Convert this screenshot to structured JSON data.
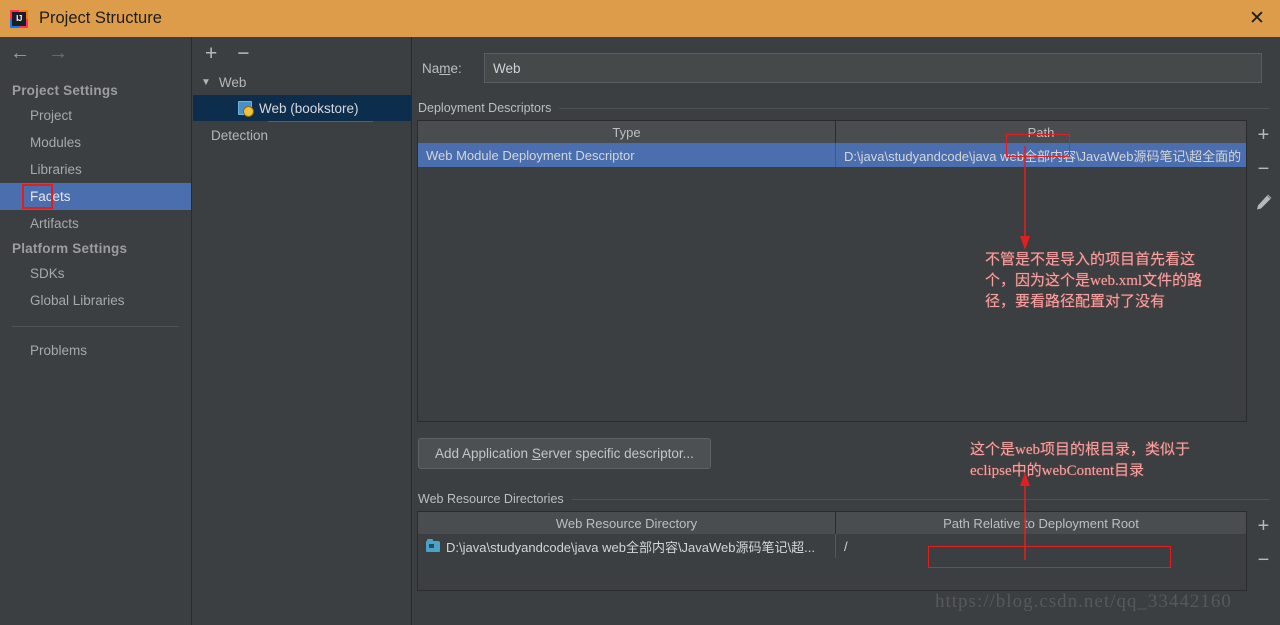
{
  "window": {
    "title": "Project Structure",
    "logo_text": "IJ",
    "close_label": "✕",
    "titlebar_color": "#dd9c4a"
  },
  "nav": {
    "back_label": "←",
    "forward_label": "→"
  },
  "sidebar": {
    "groups": [
      {
        "label": "Project Settings",
        "items": [
          {
            "label": "Project",
            "selected": false,
            "boxed": false
          },
          {
            "label": "Modules",
            "selected": false,
            "boxed": false
          },
          {
            "label": "Libraries",
            "selected": false,
            "boxed": false
          },
          {
            "label": "Facets",
            "selected": true,
            "boxed": true
          },
          {
            "label": "Artifacts",
            "selected": false,
            "boxed": false
          }
        ]
      },
      {
        "label": "Platform Settings",
        "items": [
          {
            "label": "SDKs",
            "selected": false,
            "boxed": false
          },
          {
            "label": "Global Libraries",
            "selected": false,
            "boxed": false
          }
        ]
      }
    ],
    "extra_items": [
      {
        "label": "Problems",
        "selected": false,
        "boxed": false
      }
    ]
  },
  "tree_panel": {
    "toolbar": {
      "add_label": "+",
      "remove_label": "−"
    },
    "nodes": [
      {
        "label": "Web",
        "type": "root",
        "caret": "▼",
        "selected": false
      },
      {
        "label": "Web (bookstore)",
        "type": "facet",
        "selected": true
      },
      {
        "label": "Detection",
        "type": "root",
        "selected": false
      }
    ]
  },
  "main": {
    "name_field": {
      "label_prefix": "Na",
      "label_mnemonic": "m",
      "label_suffix": "e:",
      "value": "Web",
      "placeholder": ""
    },
    "deployment_descriptors": {
      "section_label": "Deployment Descriptors",
      "columns": [
        "Type",
        "Path"
      ],
      "rows": [
        {
          "type": "Web Module Deployment Descriptor",
          "path": "D:\\java\\studyandcode\\java web全部内容\\JavaWeb源码笔记\\超全面的",
          "selected": true
        }
      ],
      "side_buttons": [
        "add",
        "remove",
        "edit"
      ],
      "add_button_label": "+",
      "remove_button_label": "−",
      "edit_button_label": "pencil"
    },
    "add_descriptor_button": {
      "prefix": "Add Application ",
      "mnemonic": "S",
      "suffix": "erver specific descriptor..."
    },
    "web_resource_directories": {
      "section_label": "Web Resource Directories",
      "columns": [
        "Web Resource Directory",
        "Path Relative to Deployment Root"
      ],
      "rows": [
        {
          "directory": "D:\\java\\studyandcode\\java web全部内容\\JavaWeb源码笔记\\超...",
          "relative": "/"
        }
      ],
      "add_button_label": "+",
      "remove_button_label": "−"
    }
  },
  "annotations": {
    "note_1": "不管是不是导入的项目首先看这\n个，因为这个是web.xml文件的路\n径，要看路径配置对了没有",
    "note_2": "这个是web项目的根目录，类似于\neclipse中的webContent目录",
    "color": "#e02020"
  },
  "watermark": {
    "text": "https://blog.csdn.net/qq_33442160"
  }
}
